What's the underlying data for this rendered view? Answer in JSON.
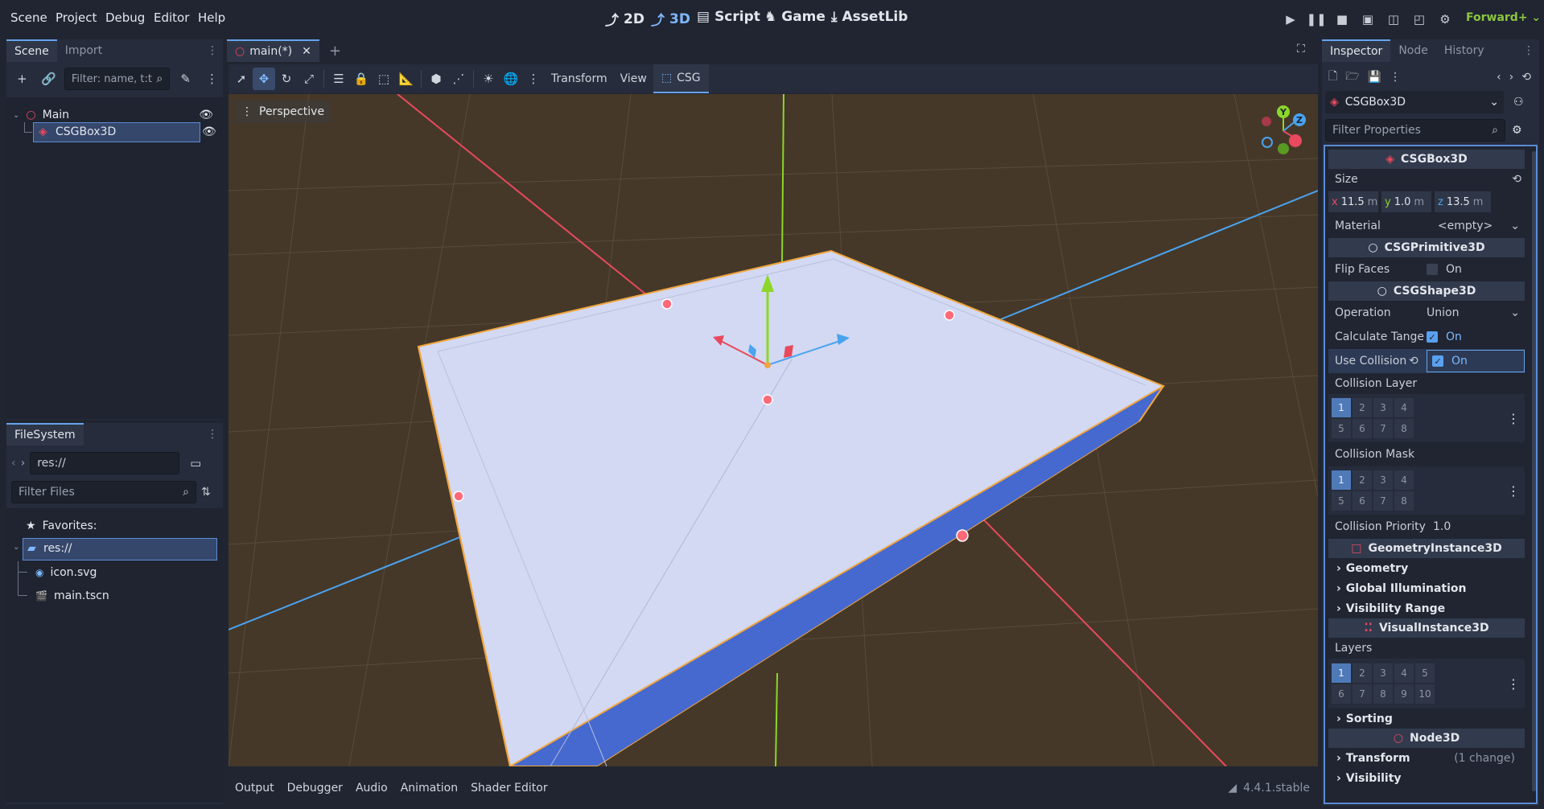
{
  "menu": [
    "Scene",
    "Project",
    "Debug",
    "Editor",
    "Help"
  ],
  "workspaces": [
    {
      "label": "2D",
      "icon": "2d-icon"
    },
    {
      "label": "3D",
      "icon": "3d-icon"
    },
    {
      "label": "Script",
      "icon": "script-icon"
    },
    {
      "label": "Game",
      "icon": "game-icon"
    },
    {
      "label": "AssetLib",
      "icon": "assetlib-icon"
    }
  ],
  "renderer": "Forward+",
  "scene_dock": {
    "tabs": [
      "Scene",
      "Import"
    ],
    "filter_placeholder": "Filter: name, t:t",
    "tree": [
      {
        "label": "Main",
        "icon": "node3d-icon"
      },
      {
        "label": "CSGBox3D",
        "icon": "csgbox-icon"
      }
    ]
  },
  "filesystem_dock": {
    "tab": "FileSystem",
    "path": "res://",
    "filter_placeholder": "Filter Files",
    "favorites_label": "Favorites:",
    "items": [
      {
        "label": "res://",
        "icon": "folder-icon"
      },
      {
        "label": "icon.svg",
        "icon": "image-icon"
      },
      {
        "label": "main.tscn",
        "icon": "scene-icon"
      }
    ]
  },
  "editor_tab": {
    "label": "main(*)"
  },
  "viewport_toolbar": {
    "menus": [
      "Transform",
      "View"
    ],
    "csg_label": "CSG"
  },
  "viewport": {
    "perspective_label": "Perspective",
    "gizmo_axes": [
      "Y",
      "Z"
    ]
  },
  "bottom_panel": {
    "tabs": [
      "Output",
      "Debugger",
      "Audio",
      "Animation",
      "Shader Editor"
    ],
    "version": "4.4.1.stable"
  },
  "inspector": {
    "tabs": [
      "Inspector",
      "Node",
      "History"
    ],
    "object_name": "CSGBox3D",
    "filter_placeholder": "Filter Properties",
    "sections": {
      "csgbox": "CSGBox3D",
      "csgprimitive": "CSGPrimitive3D",
      "csgshape": "CSGShape3D",
      "geometry_instance": "GeometryInstance3D",
      "visual_instance": "VisualInstance3D",
      "node3d": "Node3D"
    },
    "size_label": "Size",
    "size": {
      "x_label": "x",
      "x": "11.5",
      "y_label": "y",
      "y": "1.0",
      "z_label": "z",
      "z": "13.5",
      "unit": "m"
    },
    "material_label": "Material",
    "material_value": "<empty>",
    "flip_faces_label": "Flip Faces",
    "flip_faces_value": "On",
    "operation_label": "Operation",
    "operation_value": "Union",
    "calc_tangents_label": "Calculate Tange",
    "calc_tangents_value": "On",
    "use_collision_label": "Use Collision",
    "use_collision_value": "On",
    "collision_layer_label": "Collision Layer",
    "collision_layer_cells": [
      "1",
      "2",
      "3",
      "4",
      "5",
      "6",
      "7",
      "8"
    ],
    "collision_mask_label": "Collision Mask",
    "collision_mask_cells": [
      "1",
      "2",
      "3",
      "4",
      "5",
      "6",
      "7",
      "8"
    ],
    "collision_priority_label": "Collision Priority",
    "collision_priority_value": "1.0",
    "geometry_groups": [
      "Geometry",
      "Global Illumination",
      "Visibility Range"
    ],
    "layers_label": "Layers",
    "layers_cells": [
      "1",
      "2",
      "3",
      "4",
      "5",
      "6",
      "7",
      "8",
      "9",
      "10"
    ],
    "sorting_label": "Sorting",
    "transform_label": "Transform",
    "transform_changes": "(1 change)",
    "visibility_label": "Visibility"
  },
  "colors": {
    "accent": "#66a3ec",
    "x_axis": "#e8495c",
    "y_axis": "#8cd629",
    "z_axis": "#4aa3ef",
    "box_top": "#d3d9f2",
    "box_side": "#4669cf",
    "ground": "#453829"
  }
}
